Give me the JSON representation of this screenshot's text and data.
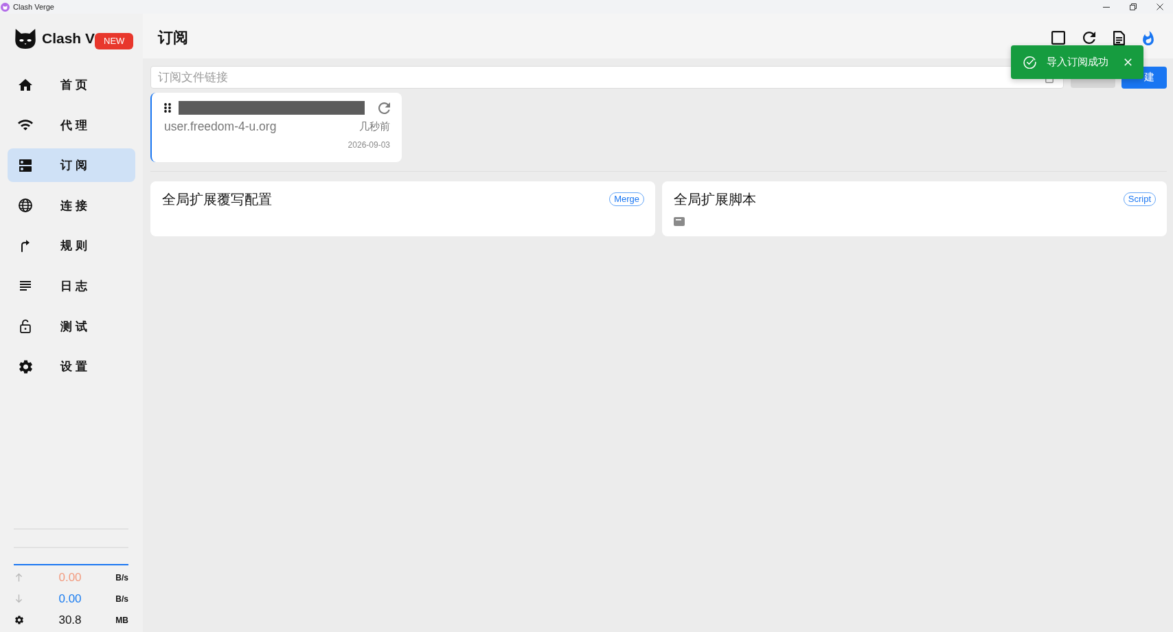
{
  "window": {
    "title": "Clash Verge"
  },
  "sidebar": {
    "logo_text": "Clash V",
    "badge": "NEW",
    "nav_items": [
      {
        "label": "首页",
        "selected": false
      },
      {
        "label": "代理",
        "selected": false
      },
      {
        "label": "订阅",
        "selected": true
      },
      {
        "label": "连接",
        "selected": false
      },
      {
        "label": "规则",
        "selected": false
      },
      {
        "label": "日志",
        "selected": false
      },
      {
        "label": "测试",
        "selected": false
      },
      {
        "label": "设置",
        "selected": false
      }
    ],
    "traffic": [
      {
        "kind": "upload",
        "value": "0.00",
        "unit": "B/s",
        "color": "#f29a7e"
      },
      {
        "kind": "download",
        "value": "0.00",
        "unit": "B/s",
        "color": "#1a7cf0"
      },
      {
        "kind": "memory",
        "value": "30.8",
        "unit": "MB",
        "color": "#111111"
      }
    ]
  },
  "header": {
    "title": "订阅"
  },
  "import_bar": {
    "placeholder": "订阅文件链接",
    "import_button": {
      "disabled": true
    },
    "new_button": {
      "label": "建"
    }
  },
  "profiles": [
    {
      "host": "user.freedom-4-u.org",
      "updated": "几秒前",
      "expires": "2026-09-03",
      "selected": true
    }
  ],
  "global_cards": [
    {
      "kind": "merge",
      "title": "全局扩展覆写配置",
      "badge": "Merge"
    },
    {
      "kind": "script",
      "title": "全局扩展脚本",
      "badge": "Script"
    }
  ],
  "toast": {
    "kind": "success",
    "message": "导入订阅成功"
  }
}
